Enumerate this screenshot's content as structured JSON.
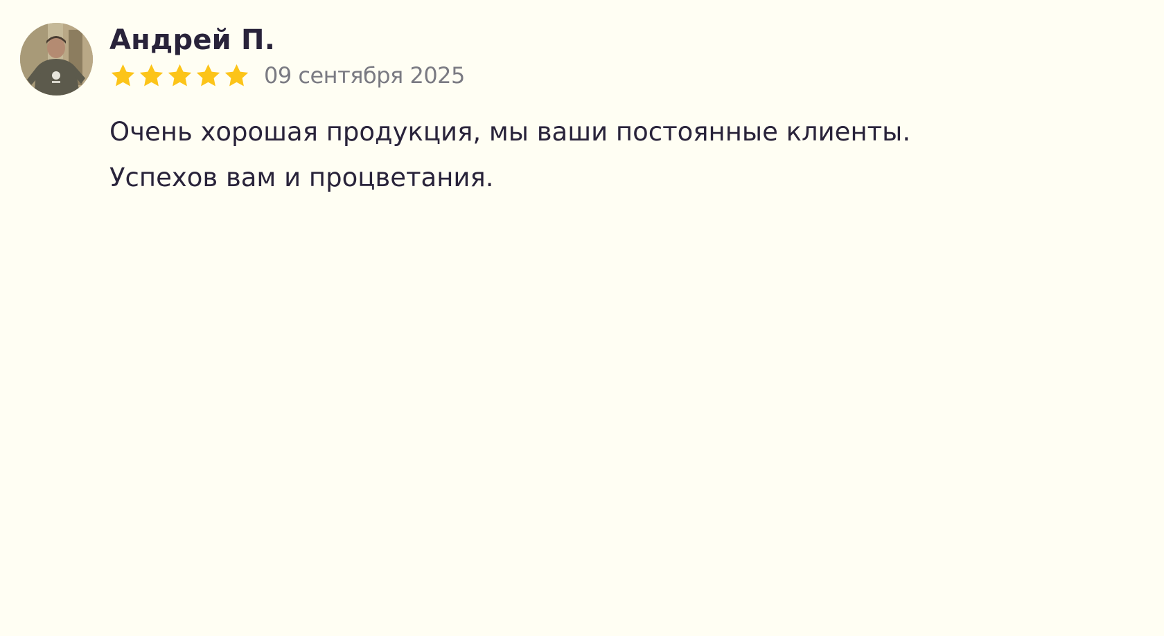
{
  "review": {
    "author": "Андрей П.",
    "rating": 5,
    "rating_max": 5,
    "star_icon": "star-icon",
    "star_color": "#fcc419",
    "date": "09 сентября 2025",
    "text_lines": [
      "Очень хорошая продукция, мы ваши постоянные клиенты.",
      "Успехов вам и процветания."
    ]
  }
}
